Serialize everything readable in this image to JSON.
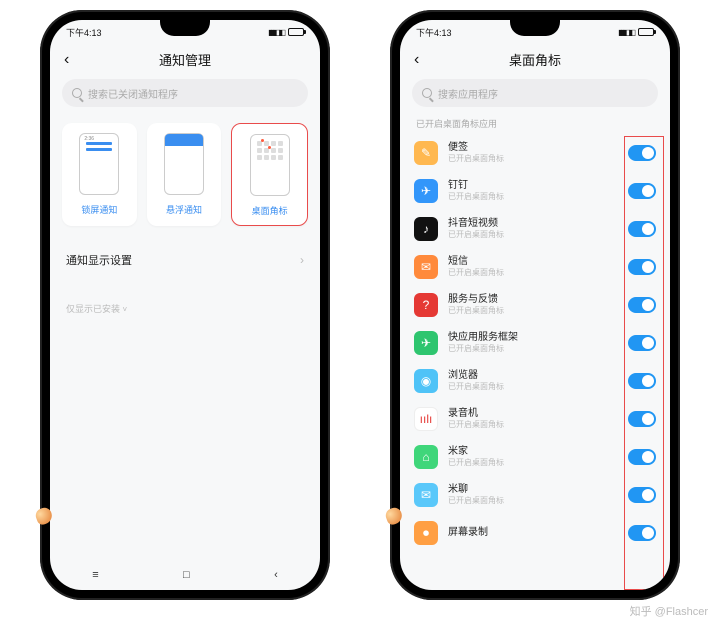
{
  "status": {
    "time": "下午4:13"
  },
  "phone_left": {
    "title": "通知管理",
    "search_placeholder": "搜索已关闭通知程序",
    "cards": [
      {
        "label": "锁屏通知"
      },
      {
        "label": "悬浮通知"
      },
      {
        "label": "桌面角标"
      }
    ],
    "setting_row": "通知显示设置",
    "footer": "仅显示已安装"
  },
  "phone_right": {
    "title": "桌面角标",
    "search_placeholder": "搜索应用程序",
    "section": "已开启桌面角标应用",
    "sub": "已开启桌面角标",
    "apps": [
      {
        "name": "便签"
      },
      {
        "name": "钉钉"
      },
      {
        "name": "抖音短视频"
      },
      {
        "name": "短信"
      },
      {
        "name": "服务与反馈"
      },
      {
        "name": "快应用服务框架"
      },
      {
        "name": "浏览器"
      },
      {
        "name": "录音机"
      },
      {
        "name": "米家"
      },
      {
        "name": "米聊"
      },
      {
        "name": "屏幕录制"
      }
    ]
  },
  "watermark": "知乎 @Flashcer"
}
